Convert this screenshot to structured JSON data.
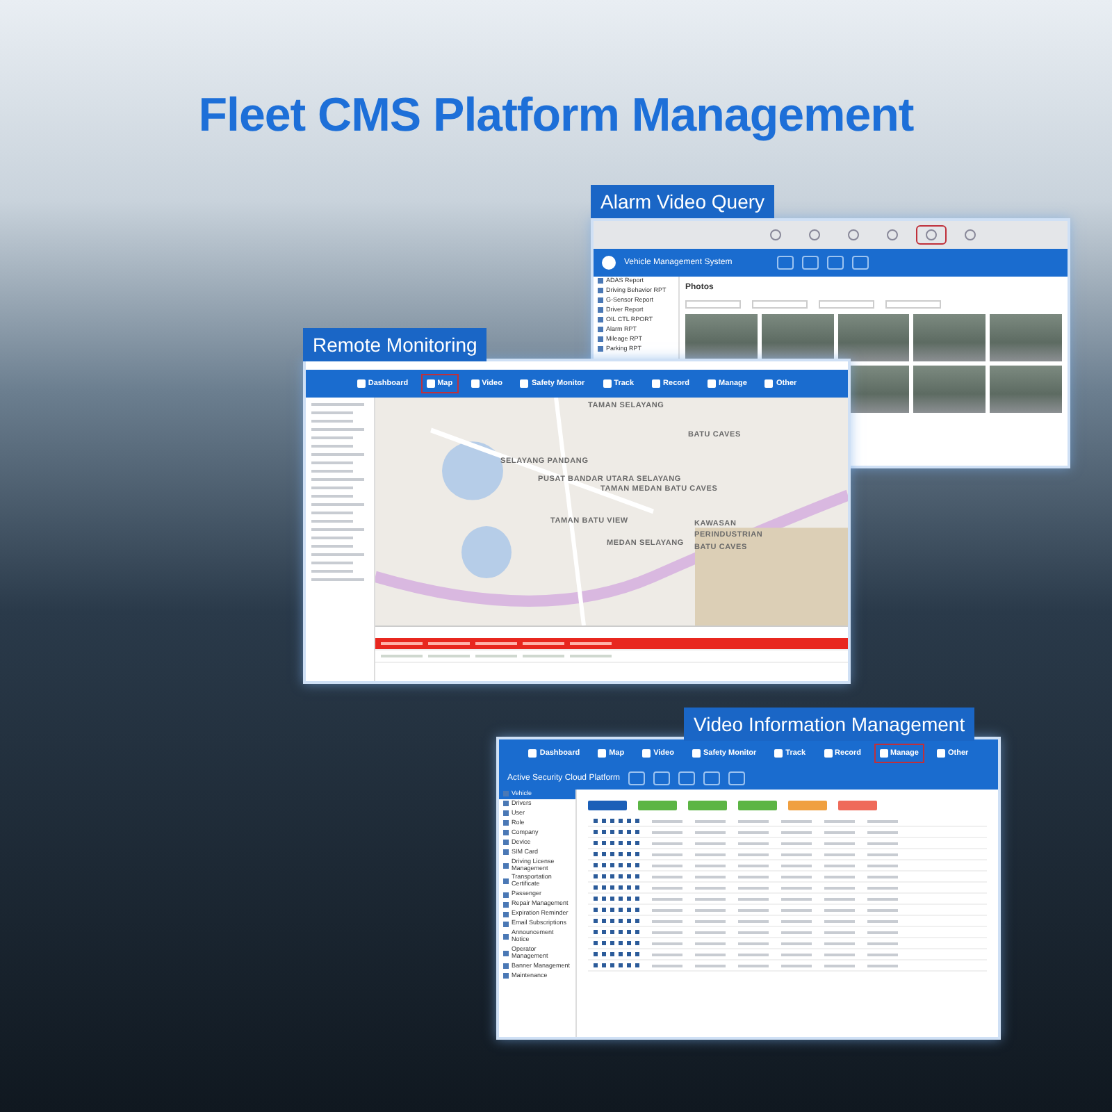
{
  "title": "Fleet CMS Platform Management",
  "alarm_window": {
    "label": "Alarm Video Query",
    "app_title": "Vehicle Management System",
    "toolbar": [
      {
        "selected": false
      },
      {
        "selected": false
      },
      {
        "selected": false
      },
      {
        "selected": false
      },
      {
        "selected": true
      },
      {
        "selected": false
      }
    ],
    "sidebar": [
      "ADAS Report",
      "Driving Behavior RPT",
      "G-Sensor Report",
      "Driver Report",
      "OIL CTL RPORT",
      "Alarm RPT",
      "Mileage RPT",
      "Parking RPT"
    ],
    "section": "Photos"
  },
  "monitor_window": {
    "label": "Remote Monitoring",
    "nav": [
      {
        "label": "Dashboard",
        "selected": false
      },
      {
        "label": "Map",
        "selected": true
      },
      {
        "label": "Video",
        "selected": false
      },
      {
        "label": "Safety Monitor",
        "selected": false
      },
      {
        "label": "Track",
        "selected": false
      },
      {
        "label": "Record",
        "selected": false
      },
      {
        "label": "Manage",
        "selected": false
      },
      {
        "label": "Other",
        "selected": false
      }
    ],
    "map_labels": [
      "TAMAN SELAYANG",
      "BATU CAVES",
      "SELAYANG PANDANG",
      "PUSAT BANDAR UTARA SELAYANG",
      "TAMAN MEDAN BATU CAVES",
      "TAMAN BATU VIEW",
      "MEDAN SELAYANG",
      "KAWASAN PERINDUSTRIAN BATU CAVES"
    ],
    "rows": [
      {
        "alarm": true
      },
      {
        "alarm": false
      }
    ]
  },
  "manage_window": {
    "label": "Video Information Management",
    "platform": "Active Security Cloud Platform",
    "nav": [
      {
        "label": "Dashboard",
        "selected": false
      },
      {
        "label": "Map",
        "selected": false
      },
      {
        "label": "Video",
        "selected": false
      },
      {
        "label": "Safety Monitor",
        "selected": false
      },
      {
        "label": "Track",
        "selected": false
      },
      {
        "label": "Record",
        "selected": false
      },
      {
        "label": "Manage",
        "selected": true
      },
      {
        "label": "Other",
        "selected": false
      }
    ],
    "sidebar": [
      {
        "label": "Vehicle",
        "selected": true
      },
      {
        "label": "Drivers",
        "selected": false
      },
      {
        "label": "User",
        "selected": false
      },
      {
        "label": "Role",
        "selected": false
      },
      {
        "label": "Company",
        "selected": false
      },
      {
        "label": "Device",
        "selected": false
      },
      {
        "label": "SIM Card",
        "selected": false
      },
      {
        "label": "Driving License Management",
        "selected": false
      },
      {
        "label": "Transportation Certificate",
        "selected": false
      },
      {
        "label": "Passenger",
        "selected": false
      },
      {
        "label": "Repair Management",
        "selected": false
      },
      {
        "label": "Expiration Reminder",
        "selected": false
      },
      {
        "label": "Email Subscriptions",
        "selected": false
      },
      {
        "label": "Announcement Notice",
        "selected": false
      },
      {
        "label": "Operator Management",
        "selected": false
      },
      {
        "label": "Banner Management",
        "selected": false
      },
      {
        "label": "Maintenance",
        "selected": false
      }
    ],
    "actions": [
      {
        "color": "#1b5fb8"
      },
      {
        "color": "#5cb545"
      },
      {
        "color": "#5cb545"
      },
      {
        "color": "#5cb545"
      },
      {
        "color": "#f0a040"
      },
      {
        "color": "#ef6a5a"
      }
    ]
  }
}
